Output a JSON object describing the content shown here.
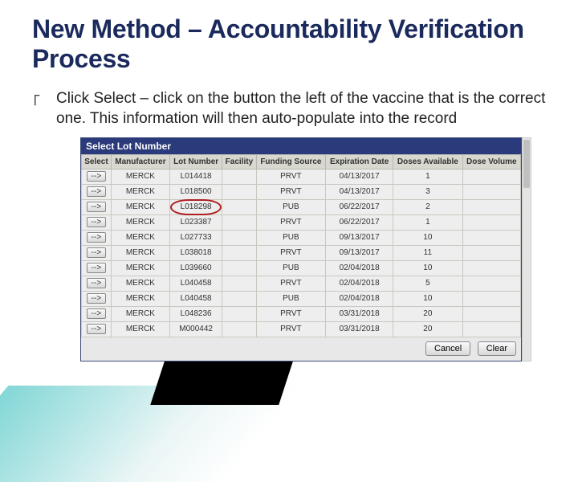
{
  "title": "New Method – Accountability Verification Process",
  "bullet_glyph": "｢",
  "body": "Click Select – click on the button the left of the vaccine that is the correct one.  This information will then auto-populate into the record",
  "dialog": {
    "title": "Select Lot Number",
    "headers": [
      "Select",
      "Manufacturer",
      "Lot Number",
      "Facility",
      "Funding Source",
      "Expiration Date",
      "Doses Available",
      "Dose Volume"
    ],
    "select_label": "-->",
    "rows": [
      {
        "mfr": "MERCK",
        "lot": "L014418",
        "fund": "PRVT",
        "exp": "04/13/2017",
        "doses": "1",
        "vol": ""
      },
      {
        "mfr": "MERCK",
        "lot": "L018500",
        "fund": "PRVT",
        "exp": "04/13/2017",
        "doses": "3",
        "vol": ""
      },
      {
        "mfr": "MERCK",
        "lot": "L018298",
        "fund": "PUB",
        "exp": "06/22/2017",
        "doses": "2",
        "vol": "",
        "circled": true
      },
      {
        "mfr": "MERCK",
        "lot": "L023387",
        "fund": "PRVT",
        "exp": "06/22/2017",
        "doses": "1",
        "vol": ""
      },
      {
        "mfr": "MERCK",
        "lot": "L027733",
        "fund": "PUB",
        "exp": "09/13/2017",
        "doses": "10",
        "vol": ""
      },
      {
        "mfr": "MERCK",
        "lot": "L038018",
        "fund": "PRVT",
        "exp": "09/13/2017",
        "doses": "11",
        "vol": ""
      },
      {
        "mfr": "MERCK",
        "lot": "L039660",
        "fund": "PUB",
        "exp": "02/04/2018",
        "doses": "10",
        "vol": ""
      },
      {
        "mfr": "MERCK",
        "lot": "L040458",
        "fund": "PRVT",
        "exp": "02/04/2018",
        "doses": "5",
        "vol": ""
      },
      {
        "mfr": "MERCK",
        "lot": "L040458",
        "fund": "PUB",
        "exp": "02/04/2018",
        "doses": "10",
        "vol": ""
      },
      {
        "mfr": "MERCK",
        "lot": "L048236",
        "fund": "PRVT",
        "exp": "03/31/2018",
        "doses": "20",
        "vol": ""
      },
      {
        "mfr": "MERCK",
        "lot": "M000442",
        "fund": "PRVT",
        "exp": "03/31/2018",
        "doses": "20",
        "vol": ""
      }
    ],
    "buttons": {
      "cancel": "Cancel",
      "clear": "Clear"
    }
  }
}
